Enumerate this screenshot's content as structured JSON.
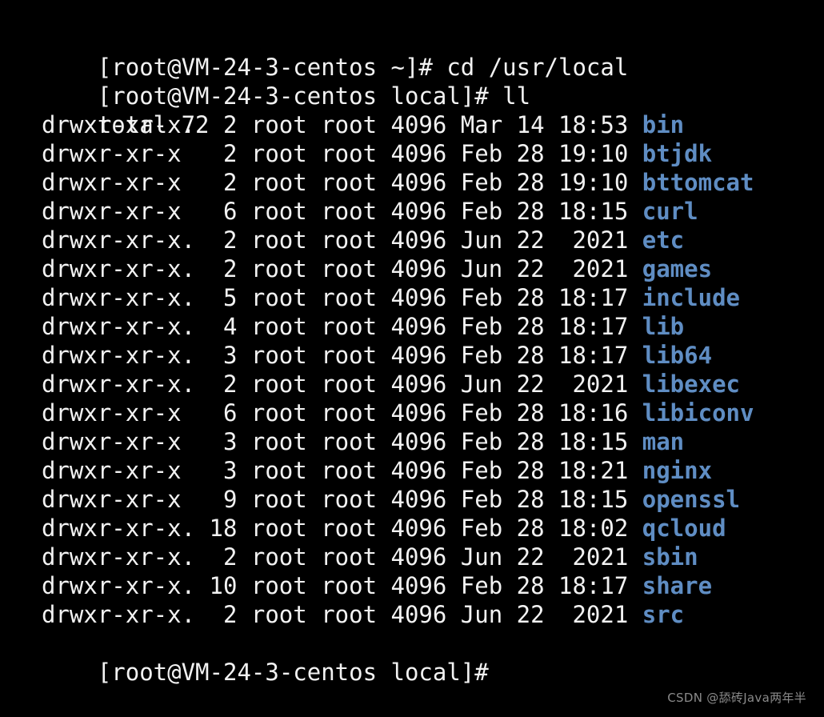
{
  "terminal": {
    "background_color": "#000000",
    "text_color": "#f2f2f2",
    "dir_color": "#5f8dc3",
    "prompt_host": "[root@VM-24-3-centos",
    "lines": {
      "cmd1": "[root@VM-24-3-centos ~]# cd /usr/local",
      "cmd2": "[root@VM-24-3-centos local]# ll",
      "total": "total 72",
      "prompt_end": "[root@VM-24-3-centos local]#"
    },
    "listing": [
      {
        "perms": "drwxr-xr-x.",
        "links": " 2",
        "owner": "root",
        "group": "root",
        "size": "4096",
        "month": "Mar",
        "day": "14",
        "time": "18:53",
        "name": "bin"
      },
      {
        "perms": "drwxr-xr-x ",
        "links": " 2",
        "owner": "root",
        "group": "root",
        "size": "4096",
        "month": "Feb",
        "day": "28",
        "time": "19:10",
        "name": "btjdk"
      },
      {
        "perms": "drwxr-xr-x ",
        "links": " 2",
        "owner": "root",
        "group": "root",
        "size": "4096",
        "month": "Feb",
        "day": "28",
        "time": "19:10",
        "name": "bttomcat"
      },
      {
        "perms": "drwxr-xr-x ",
        "links": " 6",
        "owner": "root",
        "group": "root",
        "size": "4096",
        "month": "Feb",
        "day": "28",
        "time": "18:15",
        "name": "curl"
      },
      {
        "perms": "drwxr-xr-x.",
        "links": " 2",
        "owner": "root",
        "group": "root",
        "size": "4096",
        "month": "Jun",
        "day": "22",
        "time": " 2021",
        "name": "etc"
      },
      {
        "perms": "drwxr-xr-x.",
        "links": " 2",
        "owner": "root",
        "group": "root",
        "size": "4096",
        "month": "Jun",
        "day": "22",
        "time": " 2021",
        "name": "games"
      },
      {
        "perms": "drwxr-xr-x.",
        "links": " 5",
        "owner": "root",
        "group": "root",
        "size": "4096",
        "month": "Feb",
        "day": "28",
        "time": "18:17",
        "name": "include"
      },
      {
        "perms": "drwxr-xr-x.",
        "links": " 4",
        "owner": "root",
        "group": "root",
        "size": "4096",
        "month": "Feb",
        "day": "28",
        "time": "18:17",
        "name": "lib"
      },
      {
        "perms": "drwxr-xr-x.",
        "links": " 3",
        "owner": "root",
        "group": "root",
        "size": "4096",
        "month": "Feb",
        "day": "28",
        "time": "18:17",
        "name": "lib64"
      },
      {
        "perms": "drwxr-xr-x.",
        "links": " 2",
        "owner": "root",
        "group": "root",
        "size": "4096",
        "month": "Jun",
        "day": "22",
        "time": " 2021",
        "name": "libexec"
      },
      {
        "perms": "drwxr-xr-x ",
        "links": " 6",
        "owner": "root",
        "group": "root",
        "size": "4096",
        "month": "Feb",
        "day": "28",
        "time": "18:16",
        "name": "libiconv"
      },
      {
        "perms": "drwxr-xr-x ",
        "links": " 3",
        "owner": "root",
        "group": "root",
        "size": "4096",
        "month": "Feb",
        "day": "28",
        "time": "18:15",
        "name": "man"
      },
      {
        "perms": "drwxr-xr-x ",
        "links": " 3",
        "owner": "root",
        "group": "root",
        "size": "4096",
        "month": "Feb",
        "day": "28",
        "time": "18:21",
        "name": "nginx"
      },
      {
        "perms": "drwxr-xr-x ",
        "links": " 9",
        "owner": "root",
        "group": "root",
        "size": "4096",
        "month": "Feb",
        "day": "28",
        "time": "18:15",
        "name": "openssl"
      },
      {
        "perms": "drwxr-xr-x.",
        "links": "18",
        "owner": "root",
        "group": "root",
        "size": "4096",
        "month": "Feb",
        "day": "28",
        "time": "18:02",
        "name": "qcloud"
      },
      {
        "perms": "drwxr-xr-x.",
        "links": " 2",
        "owner": "root",
        "group": "root",
        "size": "4096",
        "month": "Jun",
        "day": "22",
        "time": " 2021",
        "name": "sbin"
      },
      {
        "perms": "drwxr-xr-x.",
        "links": "10",
        "owner": "root",
        "group": "root",
        "size": "4096",
        "month": "Feb",
        "day": "28",
        "time": "18:17",
        "name": "share"
      },
      {
        "perms": "drwxr-xr-x.",
        "links": " 2",
        "owner": "root",
        "group": "root",
        "size": "4096",
        "month": "Jun",
        "day": "22",
        "time": " 2021",
        "name": "src"
      }
    ]
  },
  "watermark": {
    "text": "CSDN @舔砖Java两年半"
  }
}
